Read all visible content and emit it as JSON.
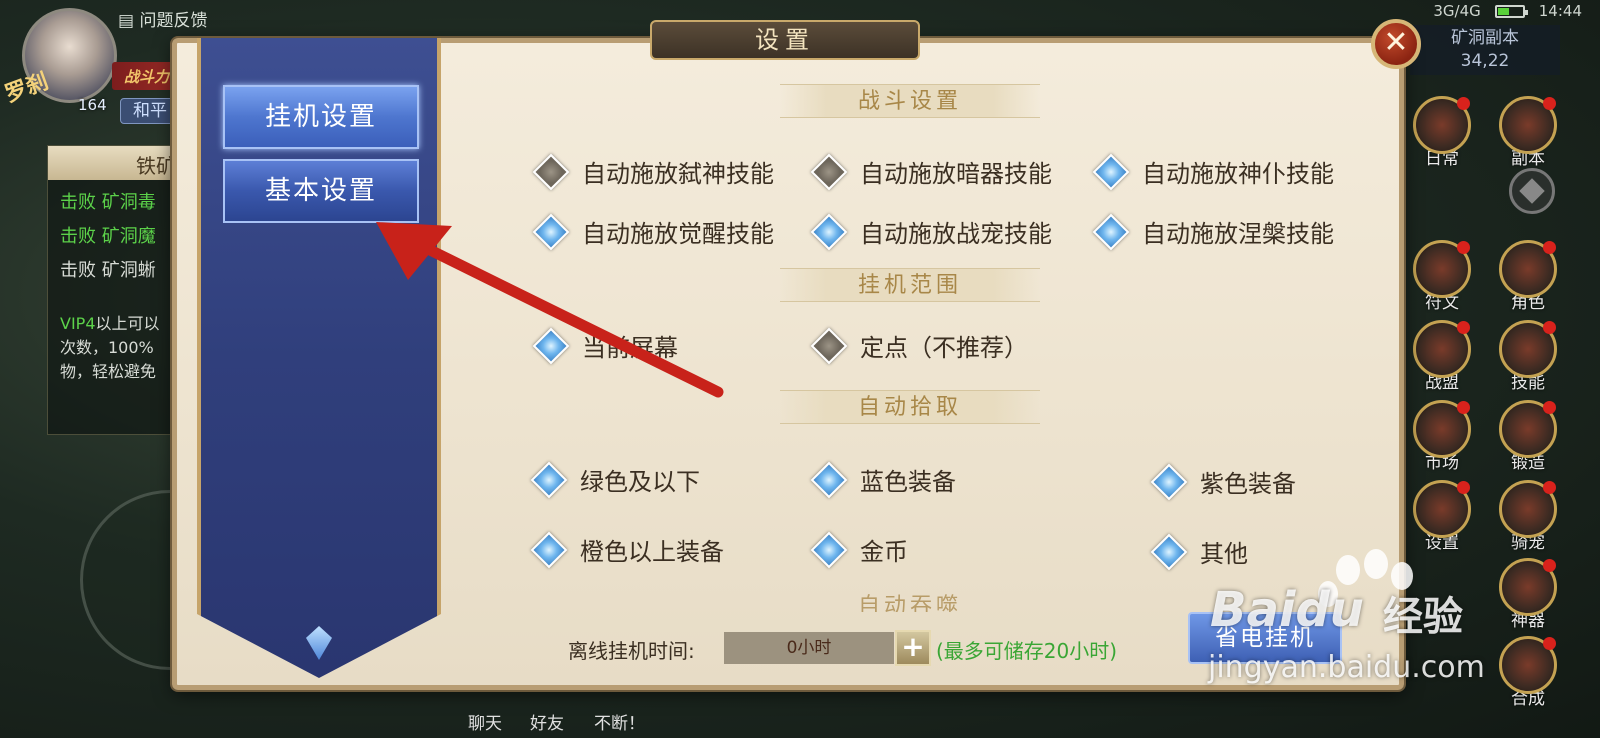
{
  "status": {
    "network": "3G/4G",
    "time": "14:44"
  },
  "hud": {
    "feedback": "问题反馈",
    "char_name": "罗刹",
    "power_label": "战斗力",
    "level": "164",
    "pk_mode": "和平",
    "quest_title": "铁矿",
    "quest_lines": [
      "击败 矿洞毒",
      "击败 矿洞魔",
      "击败 矿洞蜥"
    ],
    "quest_vip_prefix": "VIP4",
    "quest_vip_lines": [
      "以上可以",
      "次数，100%",
      "物，轻松避免"
    ],
    "map_name": "矿洞副本",
    "map_coords": "34,22",
    "side_buttons": [
      "日常",
      "副本",
      "符文",
      "角色",
      "战盟",
      "技能",
      "市场",
      "锻造",
      "设置",
      "骑宠",
      "神器",
      "合成"
    ],
    "chat": "聊天",
    "friends": "好友",
    "bottom_msg": "不断！"
  },
  "dialog": {
    "title": "设置",
    "close_label": "✕",
    "tabs": [
      "挂机设置",
      "基本设置"
    ],
    "active_tab": 0,
    "sections": {
      "combat": {
        "title": "战斗设置",
        "options": [
          {
            "label": "自动施放弑神技能",
            "checked": false
          },
          {
            "label": "自动施放暗器技能",
            "checked": false
          },
          {
            "label": "自动施放神仆技能",
            "checked": true
          },
          {
            "label": "自动施放觉醒技能",
            "checked": true
          },
          {
            "label": "自动施放战宠技能",
            "checked": true
          },
          {
            "label": "自动施放涅槃技能",
            "checked": true
          }
        ]
      },
      "range": {
        "title": "挂机范围",
        "options": [
          {
            "label": "当前屏幕",
            "checked": true
          },
          {
            "label": "定点（不推荐）",
            "checked": false
          }
        ]
      },
      "pickup": {
        "title": "自动拾取",
        "options": [
          {
            "label": "绿色及以下",
            "checked": true
          },
          {
            "label": "蓝色装备",
            "checked": true
          },
          {
            "label": "紫色装备",
            "checked": true
          },
          {
            "label": "橙色以上装备",
            "checked": true
          },
          {
            "label": "金币",
            "checked": true
          },
          {
            "label": "其他",
            "checked": true
          }
        ]
      },
      "devour_title": "自动吞噬"
    },
    "offline": {
      "label": "离线挂机时间:",
      "value": "0小时",
      "plus": "+",
      "note": "(最多可储存20小时)"
    },
    "power_save": "省电挂机"
  },
  "watermark": {
    "brand": "Baidu",
    "sub": "经验",
    "url": "jingyan.baidu.com"
  },
  "colors": {
    "accent_blue": "#3a58ad",
    "checked": "#6fb6ee",
    "unchecked": "#6d665b",
    "note_green": "#3aa635",
    "arrow": "#c8221a"
  }
}
